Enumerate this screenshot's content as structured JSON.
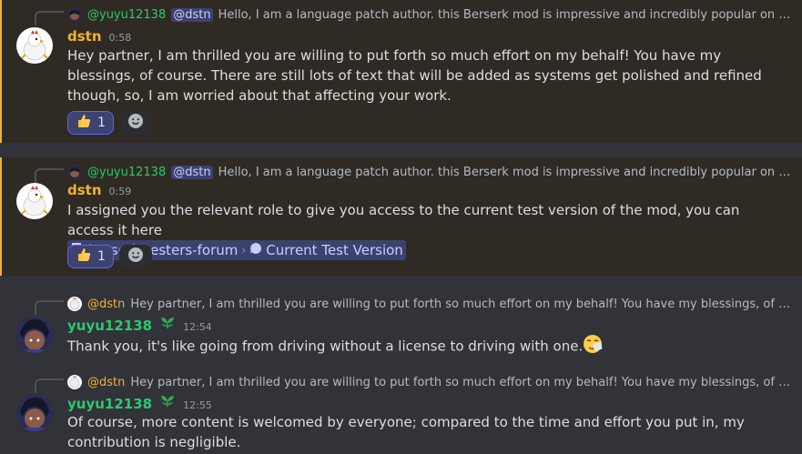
{
  "colors": {
    "dstn": "#f0b232",
    "yuyu": "#2dc770",
    "mention_bg": "#3c4270",
    "mention_text": "#c9cdfb",
    "highlight_bar": "#f0b232"
  },
  "messages": [
    {
      "reply_name": "@yuyu12138",
      "reply_mention": "@dstn",
      "reply_text": "Hello, I am a language patch author. this Berserk mod is impressive and incredibly popular on the chinese in...",
      "author": "dstn",
      "timestamp": "0:58",
      "text": "Hey partner, I am thrilled you are willing to put forth so much effort on my behalf! You have my blessings, of course. There are still lots of text that will be added as systems get polished and refined though, so, I am worried about that affecting your work.",
      "reaction_emoji": "thumbs-up-icon",
      "reaction_count": "1"
    },
    {
      "reply_name": "@yuyu12138",
      "reply_mention": "@dstn",
      "reply_text": "Hello, I am a language patch author. this Berserk mod is impressive and incredibly popular on the chinese in...",
      "author": "dstn",
      "timestamp": "0:59",
      "text": "I assigned you the relevant role to give you access to the current test version of the mod, you can access it here",
      "channel": "berserk-testers-forum",
      "thread": "Current Test Version",
      "reaction_emoji": "thumbs-up-icon",
      "reaction_count": "1"
    },
    {
      "reply_name": "@dstn",
      "reply_text": "Hey partner, I am thrilled you are willing to put forth so much effort on my behalf! You have my blessings, of course. There ...",
      "author": "yuyu12138",
      "timestamp": "12:54",
      "text": "Thank you, it's like going from driving without a license to driving with one."
    },
    {
      "reply_name": "@dstn",
      "reply_text": "Hey partner, I am thrilled you are willing to put forth so much effort on my behalf! You have my blessings, of course. There ...",
      "author": "yuyu12138",
      "timestamp": "12:55",
      "text": "Of course, more content is welcomed by everyone; compared to the time and effort you put in, my contribution is negligible."
    }
  ]
}
